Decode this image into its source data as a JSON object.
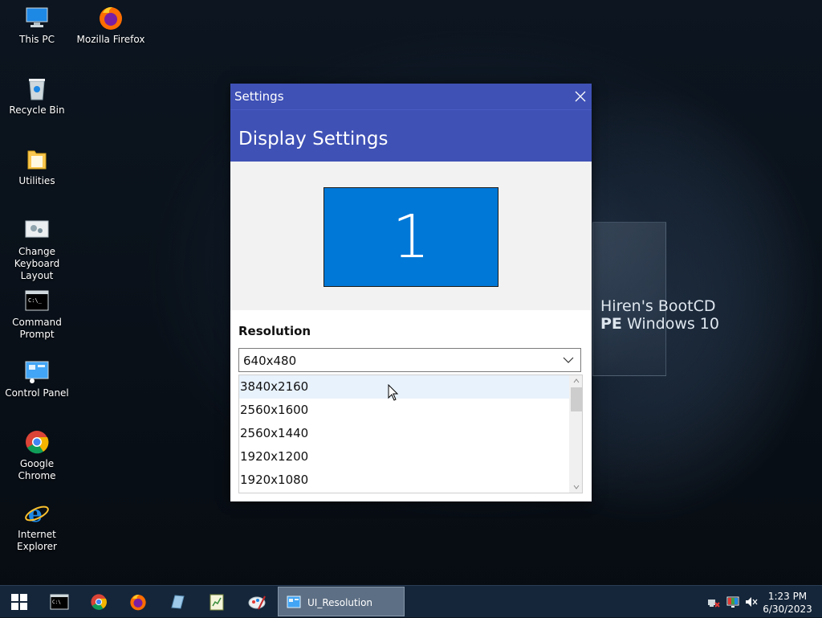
{
  "desktop": {
    "icons": [
      {
        "label": "This PC",
        "icon": "this-pc-icon"
      },
      {
        "label": "Mozilla Firefox",
        "icon": "firefox-icon"
      },
      {
        "label": "Recycle Bin",
        "icon": "recycle-bin-icon"
      },
      {
        "label": "Utilities",
        "icon": "folder-icon"
      },
      {
        "label": "Change\nKeyboard Layout",
        "icon": "keyboard-layout-icon"
      },
      {
        "label": "Command\nPrompt",
        "icon": "command-prompt-icon"
      },
      {
        "label": "Control Panel",
        "icon": "control-panel-icon"
      },
      {
        "label": "Google Chrome",
        "icon": "chrome-icon"
      },
      {
        "label": "Internet Explorer",
        "icon": "internet-explorer-icon"
      }
    ],
    "brand": {
      "line1": "Hiren's BootCD",
      "line2_bold": "PE",
      "line2_rest": " Windows 10"
    }
  },
  "window": {
    "title": "Settings",
    "header": "Display Settings",
    "monitor_number": "1",
    "resolution_label": "Resolution",
    "selected_resolution": "640x480",
    "dropdown_options": [
      "3840x2160",
      "2560x1600",
      "2560x1440",
      "1920x1200",
      "1920x1080"
    ],
    "hovered_option": "3840x2160"
  },
  "taskbar": {
    "active_task": "UI_Resolution",
    "time": "1:23 PM",
    "date": "6/30/2023"
  },
  "colors": {
    "accent": "#3f51b5",
    "monitor": "#0078d7",
    "taskbar": "#15263a"
  }
}
